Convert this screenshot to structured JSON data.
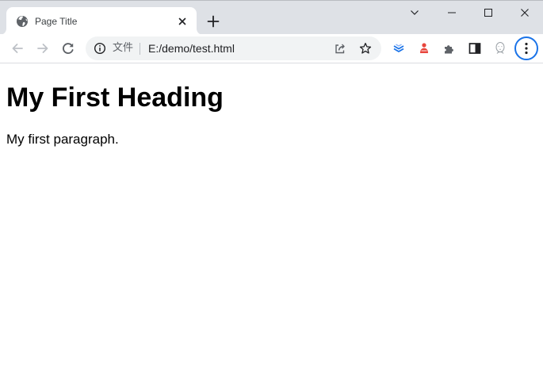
{
  "tab": {
    "title": "Page Title",
    "favicon": "globe-icon"
  },
  "window_controls": [
    "tab-search-icon",
    "minimize-icon",
    "maximize-icon",
    "close-icon"
  ],
  "toolbar": {
    "back_enabled": false,
    "forward_enabled": false,
    "extensions": [
      "stack-extension-icon",
      "person-extension-icon",
      "puzzle-icon",
      "side-panel-icon",
      "profile-avatar-icon"
    ],
    "menu": "more-vert-icon"
  },
  "omnibox": {
    "scheme_label": "文件",
    "url": "E:/demo/test.html"
  },
  "page": {
    "heading": "My First Heading",
    "paragraph": "My first paragraph."
  },
  "colors": {
    "tabstrip": "#dee1e6",
    "omnibox": "#f1f3f4",
    "accent": "#1a73e8",
    "icon": "#5f6368"
  }
}
